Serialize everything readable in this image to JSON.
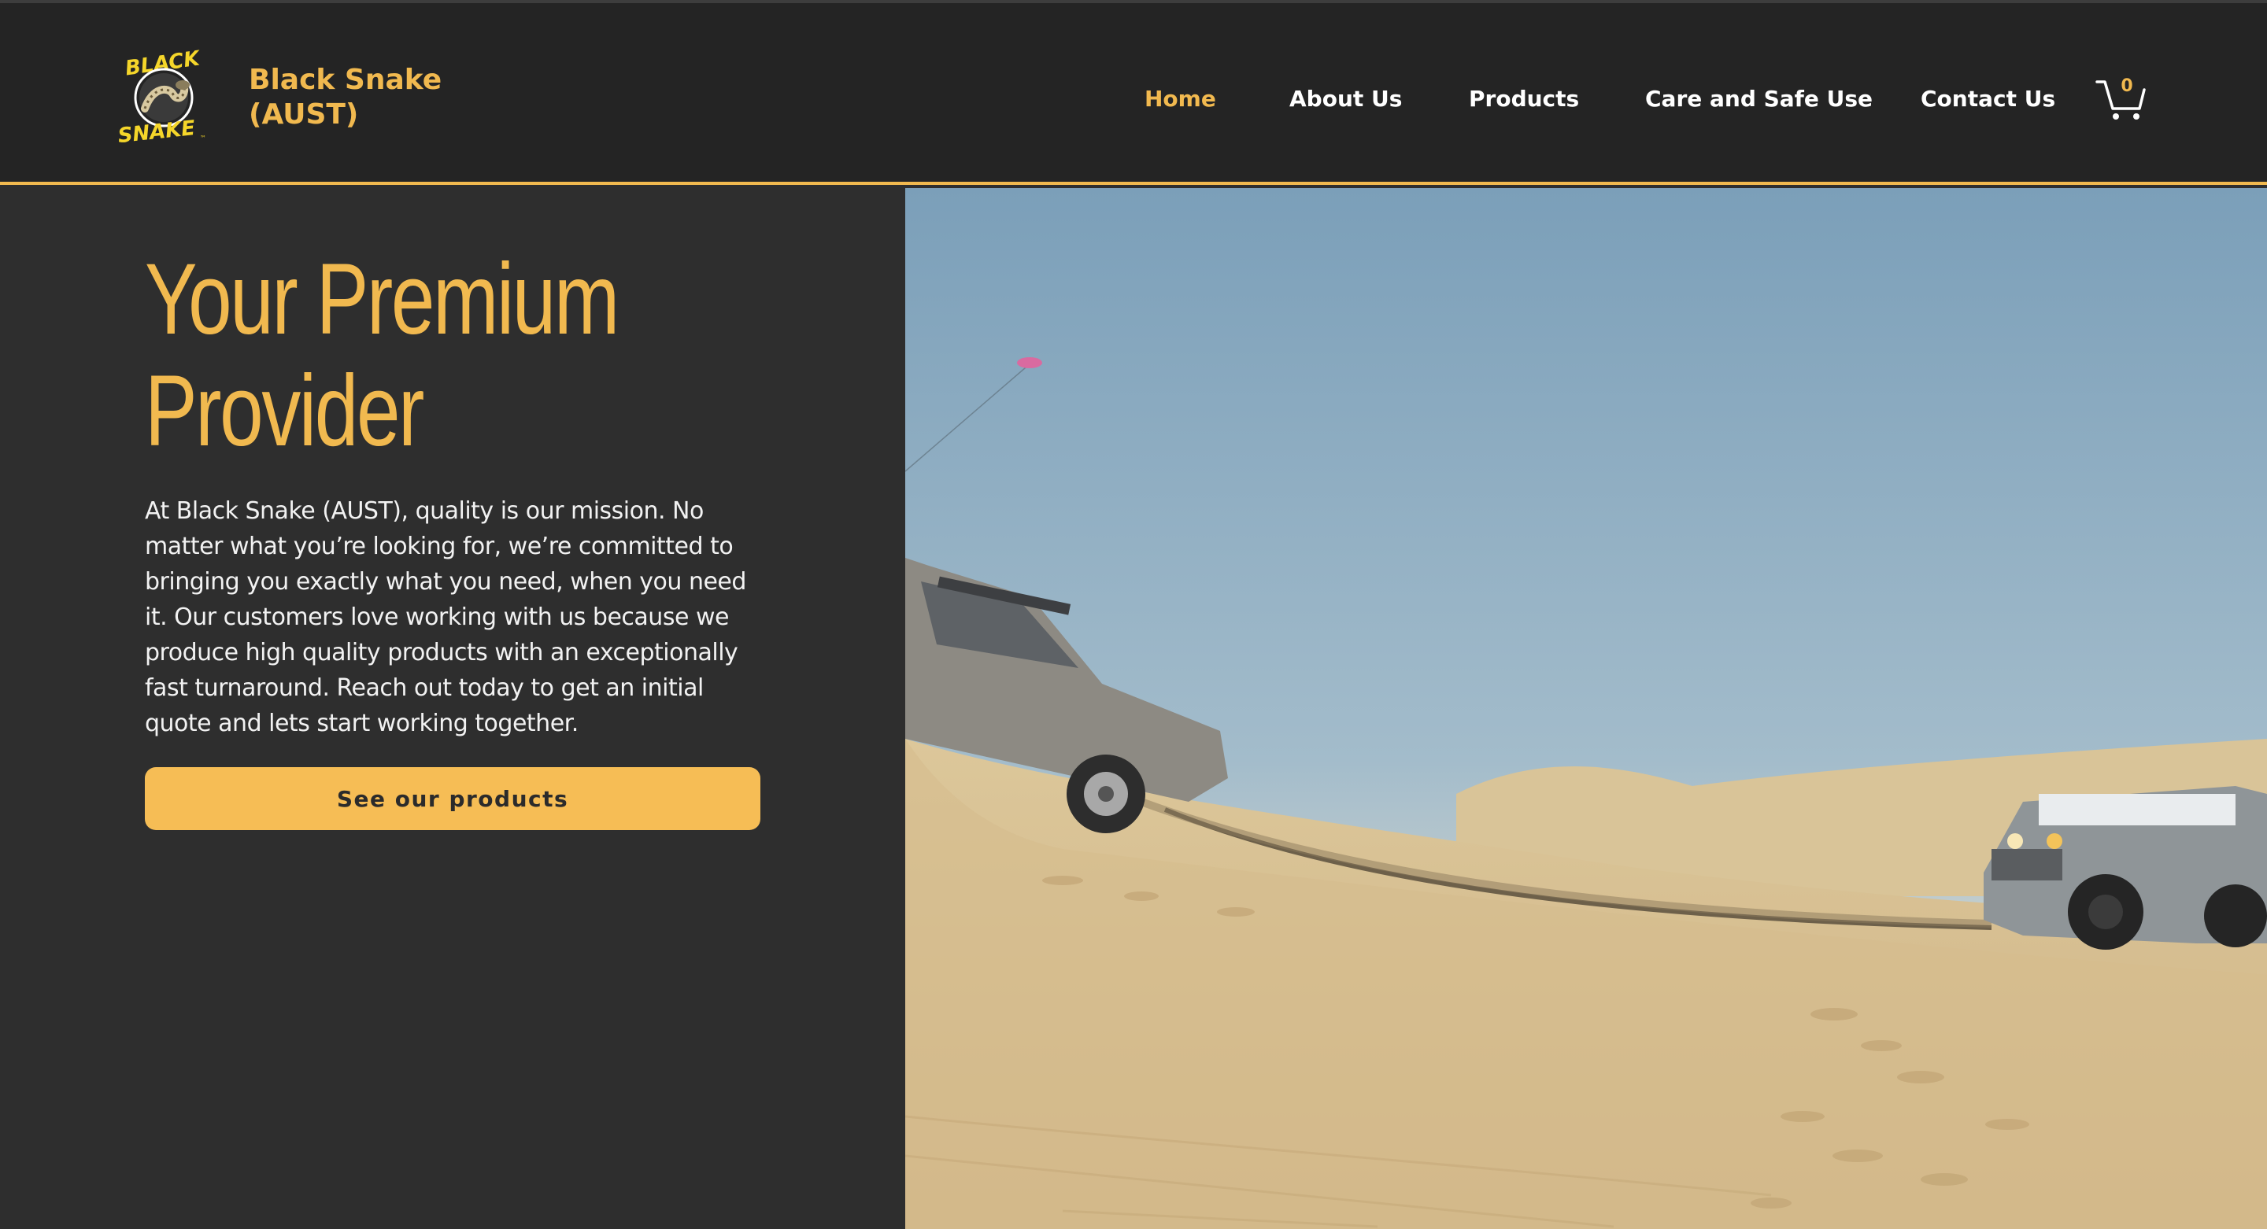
{
  "brand": {
    "logo_alt": "Black Snake logo",
    "name_line1": "Black Snake",
    "name_line2": "(AUST)"
  },
  "nav": {
    "items": [
      {
        "label": "Home",
        "active": true
      },
      {
        "label": "About Us",
        "active": false
      },
      {
        "label": "Products",
        "active": false
      },
      {
        "label": "Care and Safe Use",
        "active": false
      },
      {
        "label": "Contact Us",
        "active": false
      }
    ]
  },
  "cart": {
    "icon": "cart-icon",
    "count": "0"
  },
  "hero": {
    "title_line1": "Your Premium",
    "title_line2": "Provider",
    "body": "At Black Snake (AUST), quality is our mission. No matter what you’re looking for, we’re committed to bringing you exactly what you need, when you need it. Our customers love working with us because we produce high quality products with an exceptionally fast turnaround. Reach out today to get an initial quote and lets start working together.",
    "cta_label": "See our products"
  },
  "colors": {
    "accent": "#f1b94f",
    "header_bg": "#242424",
    "panel_bg": "#2e2e2e",
    "button_bg": "#f6bd55"
  }
}
